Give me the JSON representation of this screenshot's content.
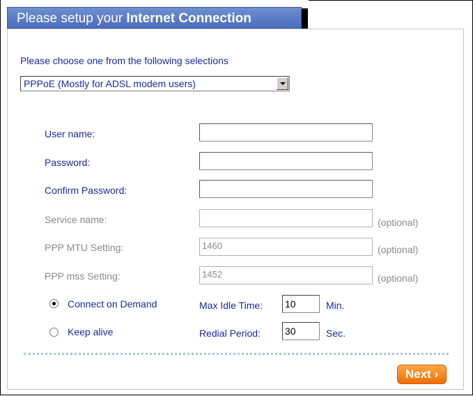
{
  "header": {
    "title_prefix": "Please setup your ",
    "title_bold": "Internet Connection"
  },
  "connection": {
    "prompt": "Please choose one from the following selections",
    "selected_type": "PPPoE (Mostly for ADSL modem users)"
  },
  "fields": {
    "user_name_label": "User name:",
    "user_name_value": "",
    "password_label": "Password:",
    "password_value": "",
    "confirm_password_label": "Confirm Password:",
    "confirm_password_value": "",
    "service_name_label": "Service name:",
    "service_name_value": "",
    "service_name_hint": "(optional)",
    "mtu_label": "PPP MTU Setting:",
    "mtu_value": "1460",
    "mtu_hint": "(optional)",
    "mss_label": "PPP mss Setting:",
    "mss_value": "1452",
    "mss_hint": "(optional)"
  },
  "mode": {
    "connect_on_demand_label": "Connect on Demand",
    "connect_on_demand_checked": true,
    "keep_alive_label": "Keep alive",
    "keep_alive_checked": false,
    "max_idle_label": "Max Idle Time:",
    "max_idle_value": "10",
    "max_idle_unit": "Min.",
    "redial_label": "Redial Period:",
    "redial_value": "30",
    "redial_unit": "Sec."
  },
  "footer": {
    "next_label": "Next ›"
  },
  "colors": {
    "header_blue": "#4a6dbd",
    "label_blue": "#1a2a9c",
    "disabled_gray": "#8a8a8a",
    "next_orange": "#ef6f00"
  }
}
